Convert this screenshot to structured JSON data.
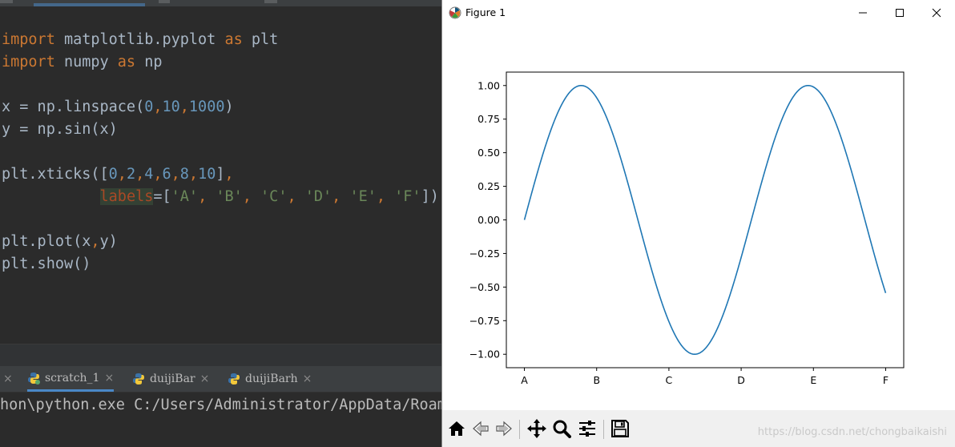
{
  "editor": {
    "code_lines": [
      "import matplotlib.pyplot as plt",
      "import numpy as np",
      "",
      "x = np.linspace(0,10,1000)",
      "y = np.sin(x)",
      "",
      "plt.xticks([0,2,4,6,8,10],",
      "           labels=['A', 'B', 'C', 'D', 'E', 'F'])",
      "",
      "plt.plot(x,y)",
      "plt.show()"
    ]
  },
  "run_panel": {
    "tabs": [
      {
        "label": "scratch_1",
        "close": "×",
        "active": true
      },
      {
        "label": "duijiBar",
        "close": "×",
        "active": false
      },
      {
        "label": "duijiBarh",
        "close": "×",
        "active": false
      }
    ],
    "left_close": "×",
    "output_line": "hon\\python.exe C:/Users/Administrator/AppData/Roam"
  },
  "figure": {
    "window_title": "Figure 1",
    "window_buttons": [
      "minimize-icon",
      "maximize-icon",
      "close-icon"
    ],
    "toolbar_icons": [
      "home-icon",
      "back-arrow-icon",
      "forward-arrow-icon",
      "pan-icon",
      "zoom-icon",
      "configure-subplots-icon",
      "save-icon"
    ],
    "watermark": "https://blog.csdn.net/chongbaikaishi"
  },
  "colors": {
    "line": "#1f77b4",
    "keyword": "#cc7832",
    "number": "#6897bb",
    "string": "#6a8759",
    "editor_bg": "#2b2b2b"
  },
  "chart_data": {
    "type": "line",
    "title": "",
    "xlabel": "",
    "ylabel": "",
    "series": [
      {
        "function": "sin",
        "x_range": [
          0,
          10
        ],
        "samples": 1000
      }
    ],
    "xlim": [
      -0.5,
      10.5
    ],
    "ylim": [
      -1.1,
      1.1
    ],
    "xticks": [
      0,
      2,
      4,
      6,
      8,
      10
    ],
    "xtick_labels": [
      "A",
      "B",
      "C",
      "D",
      "E",
      "F"
    ],
    "yticks": [
      1.0,
      0.75,
      0.5,
      0.25,
      0.0,
      -0.25,
      -0.5,
      -0.75,
      -1.0
    ],
    "ytick_labels": [
      "1.00",
      "0.75",
      "0.50",
      "0.25",
      "0.00",
      "−0.25",
      "−0.50",
      "−0.75",
      "−1.00"
    ],
    "grid": false
  }
}
